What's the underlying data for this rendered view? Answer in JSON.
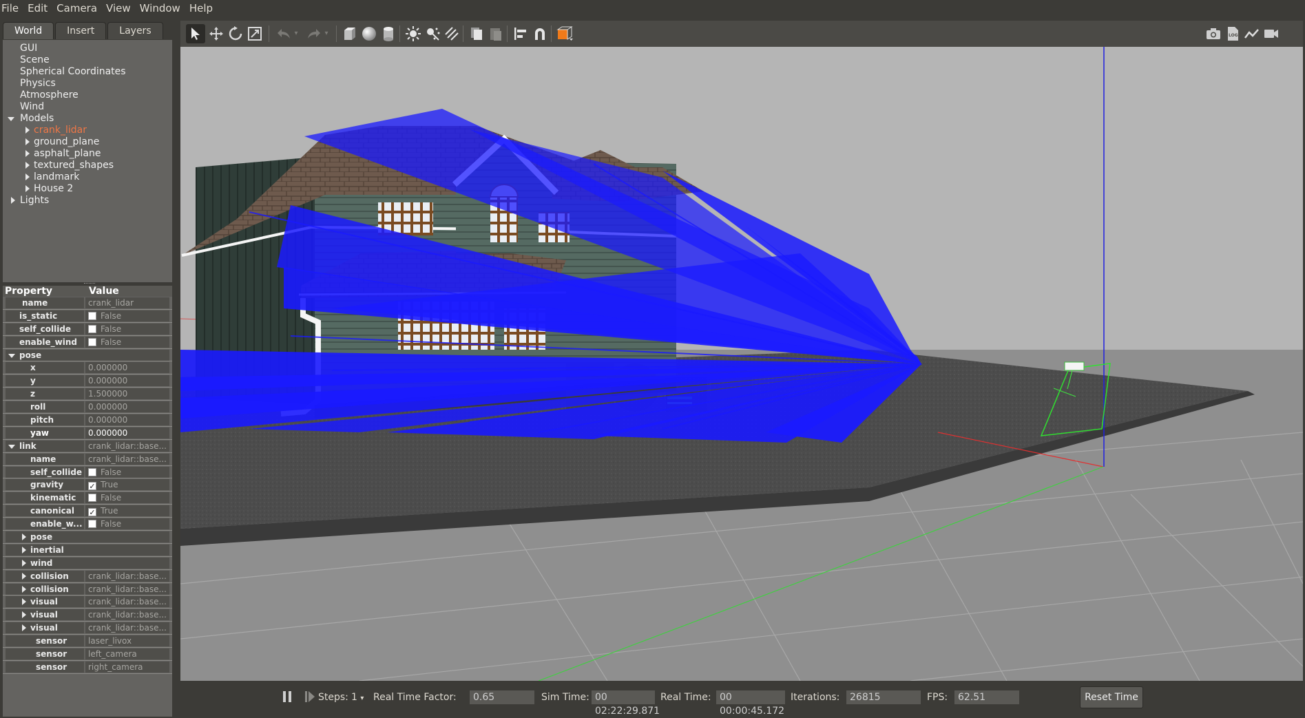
{
  "menu": [
    "File",
    "Edit",
    "Camera",
    "View",
    "Window",
    "Help"
  ],
  "tabs": [
    "World",
    "Insert",
    "Layers"
  ],
  "tree": {
    "gui": "GUI",
    "scene": "Scene",
    "spherical": "Spherical Coordinates",
    "physics": "Physics",
    "atmosphere": "Atmosphere",
    "wind": "Wind",
    "models": "Models",
    "model_items": [
      "crank_lidar",
      "ground_plane",
      "asphalt_plane",
      "textured_shapes",
      "landmark",
      "House 2"
    ],
    "lights": "Lights"
  },
  "properties": {
    "header_property": "Property",
    "header_value": "Value",
    "name_label": "name",
    "name_value": "crank_lidar",
    "is_static_label": "is_static",
    "is_static_value": "False",
    "self_collide_label": "self_collide",
    "self_collide_value": "False",
    "enable_wind_label": "enable_wind",
    "enable_wind_value": "False",
    "pose_label": "pose",
    "x_label": "x",
    "x_value": "0.000000",
    "y_label": "y",
    "y_value": "0.000000",
    "z_label": "z",
    "z_value": "1.500000",
    "roll_label": "roll",
    "roll_value": "0.000000",
    "pitch_label": "pitch",
    "pitch_value": "0.000000",
    "yaw_label": "yaw",
    "yaw_value": "0.000000",
    "link_label": "link",
    "link_value": "crank_lidar::base...",
    "link_name_label": "name",
    "link_name_value": "crank_lidar::base...",
    "link_self_collide_label": "self_collide",
    "link_self_collide_value": "False",
    "gravity_label": "gravity",
    "gravity_value": "True",
    "kinematic_label": "kinematic",
    "kinematic_value": "False",
    "canonical_label": "canonical",
    "canonical_value": "True",
    "enable_w_label": "enable_w...",
    "enable_w_value": "False",
    "link_pose_label": "pose",
    "inertial_label": "inertial",
    "wind_label": "wind",
    "collision1_label": "collision",
    "collision1_value": "crank_lidar::base...",
    "collision2_label": "collision",
    "collision2_value": "crank_lidar::base...",
    "visual1_label": "visual",
    "visual1_value": "crank_lidar::base...",
    "visual2_label": "visual",
    "visual2_value": "crank_lidar::base...",
    "visual3_label": "visual",
    "visual3_value": "crank_lidar::base...",
    "sensor1_label": "sensor",
    "sensor1_value": "laser_livox",
    "sensor2_label": "sensor",
    "sensor2_value": "left_camera",
    "sensor3_label": "sensor",
    "sensor3_value": "right_camera"
  },
  "status": {
    "steps_label": "Steps:",
    "steps_value": "1",
    "rtf_label": "Real Time Factor:",
    "rtf_value": "0.65",
    "sim_time_label": "Sim Time:",
    "sim_time_value": "00 02:22:29.871",
    "real_time_label": "Real Time:",
    "real_time_value": "00 00:00:45.172",
    "iterations_label": "Iterations:",
    "iterations_value": "26815",
    "fps_label": "FPS:",
    "fps_value": "62.51",
    "reset_label": "Reset Time"
  },
  "colors": {
    "accent_selected": "#f07746",
    "laser": "#1a1aff",
    "roof": "#6e5a4d",
    "siding": "#556a62"
  }
}
